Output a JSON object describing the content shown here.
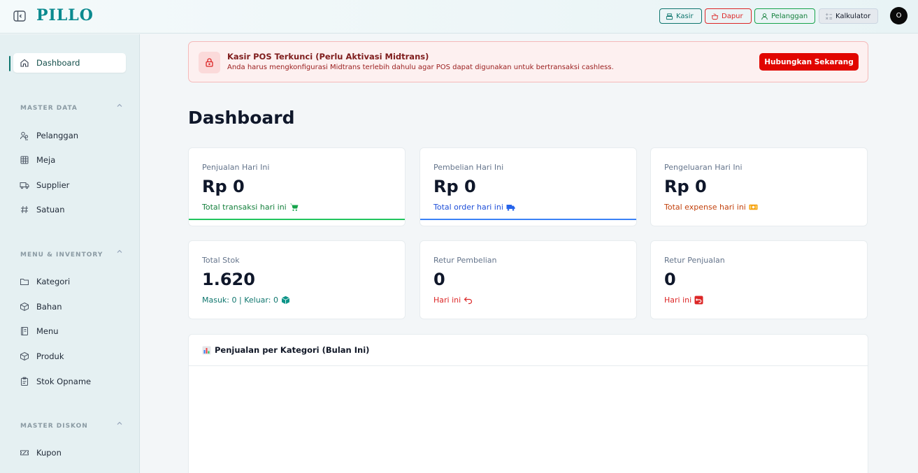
{
  "header": {
    "logo": "PILLO",
    "buttons": {
      "kasir": "Kasir",
      "dapur": "Dapur",
      "pelanggan": "Pelanggan",
      "kalkulator": "Kalkulator"
    },
    "avatar_initial": "O"
  },
  "sidebar": {
    "dashboard": "Dashboard",
    "sections": [
      {
        "label": "MASTER DATA",
        "items": [
          "Pelanggan",
          "Meja",
          "Supplier",
          "Satuan"
        ]
      },
      {
        "label": "MENU & INVENTORY",
        "items": [
          "Kategori",
          "Bahan",
          "Menu",
          "Produk",
          "Stok Opname"
        ]
      },
      {
        "label": "MASTER DISKON",
        "items": [
          "Kupon"
        ]
      }
    ]
  },
  "alert": {
    "title": "Kasir POS Terkunci (Perlu Aktivasi Midtrans)",
    "text": "Anda harus mengkonfigurasi Midtrans terlebih dahulu agar POS dapat digunakan untuk bertransaksi cashless.",
    "button": "Hubungkan Sekarang"
  },
  "page_title": "Dashboard",
  "cards": [
    {
      "label": "Penjualan Hari Ini",
      "value": "Rp 0",
      "sub": "Total transaksi hari ini",
      "icon": "cart-icon",
      "color": "#15803d",
      "accent": "#22c55e"
    },
    {
      "label": "Pembelian Hari Ini",
      "value": "Rp 0",
      "sub": "Total order hari ini",
      "icon": "truck-icon",
      "color": "#1d4ed8",
      "accent": "#3b82f6"
    },
    {
      "label": "Pengeluaran Hari Ini",
      "value": "Rp 0",
      "sub": "Total expense hari ini",
      "icon": "money-icon",
      "color": "#c2410c",
      "accent": ""
    },
    {
      "label": "Total Stok",
      "value": "1.620",
      "sub": "Masuk: 0 | Keluar: 0",
      "icon": "box-icon",
      "color": "#0f766e",
      "accent": ""
    },
    {
      "label": "Retur Pembelian",
      "value": "0",
      "sub": "Hari ini",
      "icon": "return-arrow-icon",
      "color": "#dc2626",
      "accent": ""
    },
    {
      "label": "Retur Penjualan",
      "value": "0",
      "sub": "Hari ini",
      "icon": "return-box-icon",
      "color": "#dc2626",
      "accent": ""
    }
  ],
  "chart_panel": {
    "title": "Penjualan per Kategori (Bulan Ini)",
    "icon": "bar-chart-icon"
  }
}
